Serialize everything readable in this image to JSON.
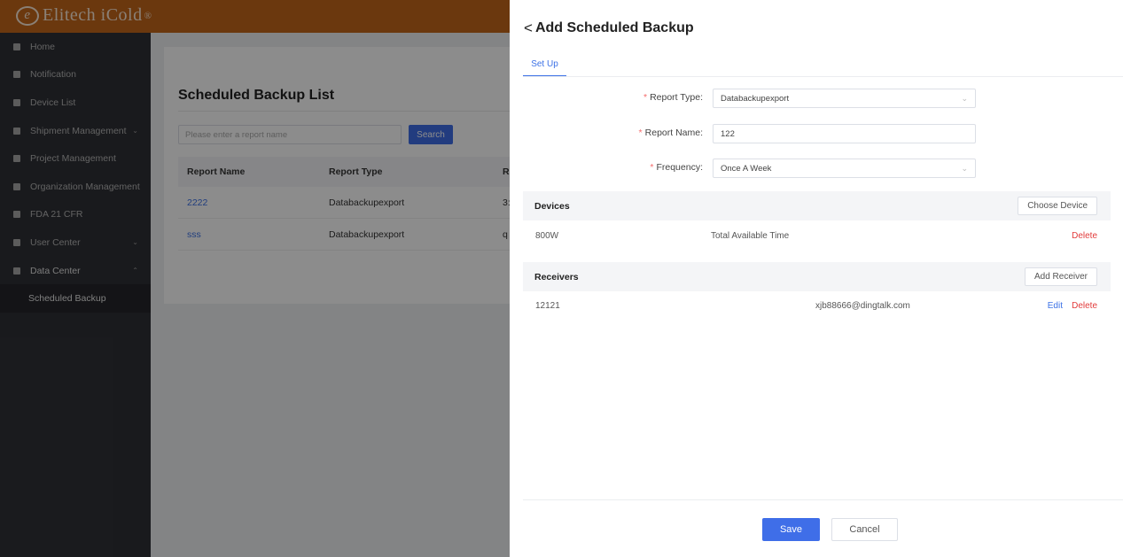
{
  "app": {
    "brand": "Elitech iCold",
    "brand_mark": "e",
    "trademark": "®"
  },
  "sidebar": {
    "items": [
      {
        "label": "Home",
        "icon": "home-icon"
      },
      {
        "label": "Notification",
        "icon": "message-icon"
      },
      {
        "label": "Device List",
        "icon": "device-icon"
      },
      {
        "label": "Shipment Management",
        "icon": "shipment-icon",
        "chevron": "⌄"
      },
      {
        "label": "Project Management",
        "icon": "project-icon"
      },
      {
        "label": "Organization Management",
        "icon": "organization-icon"
      },
      {
        "label": "FDA 21 CFR",
        "icon": "shield-icon"
      },
      {
        "label": "User Center",
        "icon": "user-icon",
        "chevron": "⌄"
      },
      {
        "label": "Data Center",
        "icon": "data-icon",
        "chevron": "⌃"
      }
    ],
    "sub_item": "Scheduled Backup"
  },
  "list": {
    "title": "Scheduled Backup List",
    "search_placeholder": "Please enter a report name",
    "search_button": "Search",
    "columns": [
      "Report Name",
      "Report Type",
      "R"
    ],
    "rows": [
      {
        "name": "2222",
        "type": "Databackupexport",
        "extra": "3:"
      },
      {
        "name": "sss",
        "type": "Databackupexport",
        "extra": "q"
      }
    ]
  },
  "drawer": {
    "back_glyph": "<",
    "title": "Add Scheduled Backup",
    "tab": "Set Up",
    "required_mark": "*",
    "fields": {
      "report_type": {
        "label": "Report Type:",
        "value": "Databackupexport"
      },
      "report_name": {
        "label": "Report Name:",
        "value": "122"
      },
      "frequency": {
        "label": "Frequency:",
        "value": "Once A Week"
      }
    },
    "devices": {
      "title": "Devices",
      "button": "Choose Device",
      "rows": [
        {
          "name": "800W",
          "time": "Total Available Time",
          "delete": "Delete"
        }
      ]
    },
    "receivers": {
      "title": "Receivers",
      "button": "Add Receiver",
      "rows": [
        {
          "name": "12121",
          "email": "xjb88666@dingtalk.com",
          "edit": "Edit",
          "delete": "Delete"
        }
      ]
    },
    "save": "Save",
    "cancel": "Cancel"
  },
  "colors": {
    "header": "#c4661a",
    "sidebar": "#2f3136",
    "primary": "#3f6ee8",
    "danger": "#e23b3b"
  }
}
